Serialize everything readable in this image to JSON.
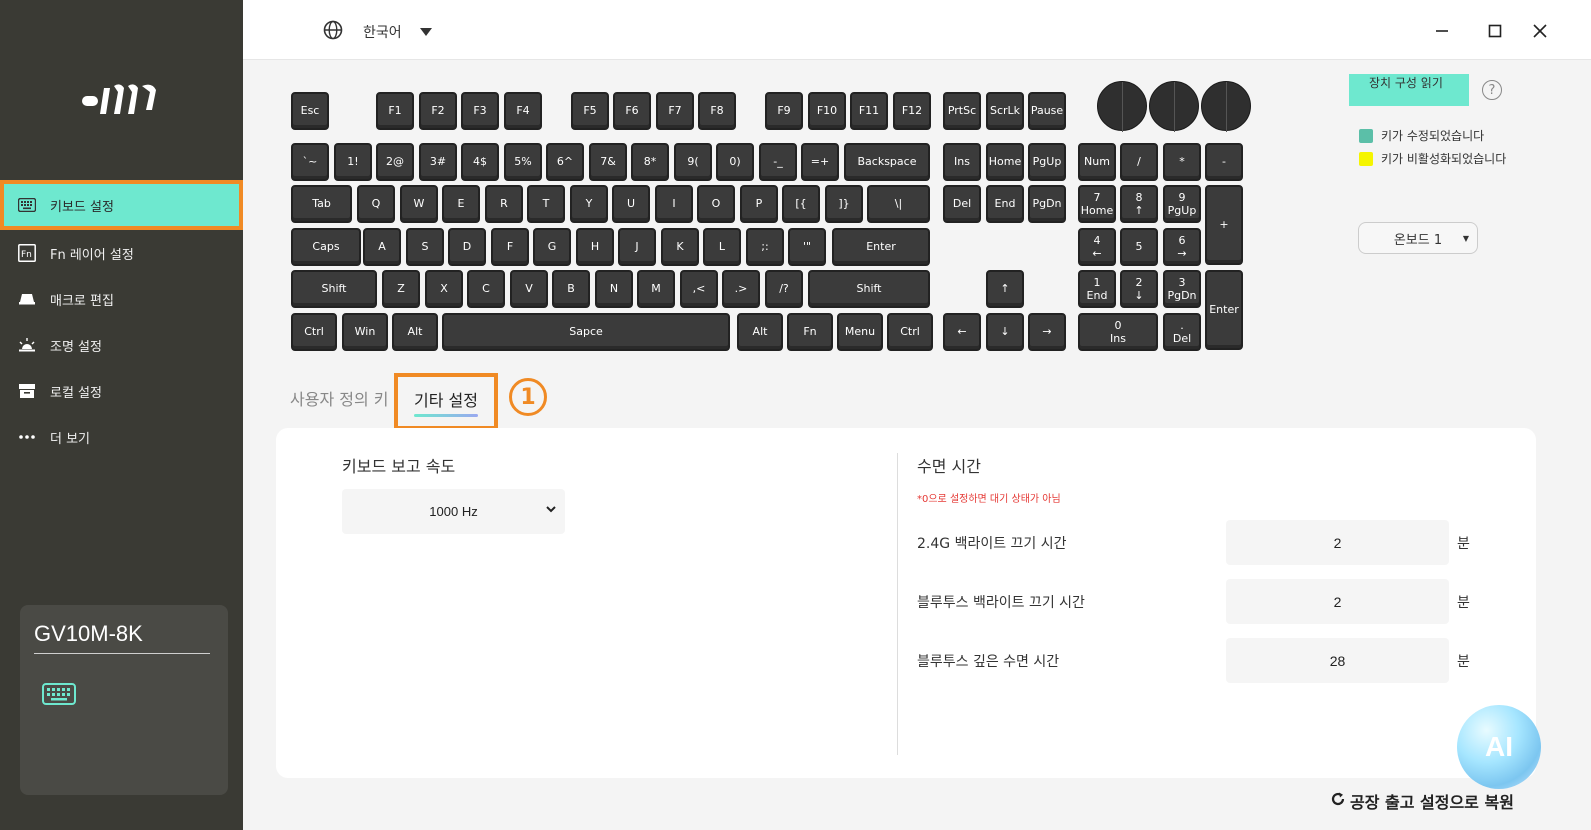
{
  "language": {
    "label": "한국어",
    "icons": [
      "globe-icon",
      "caret-down-icon"
    ]
  },
  "window_controls": {
    "minimize": "minimize-icon",
    "maximize": "maximize-icon",
    "close": "close-icon"
  },
  "sidebar": {
    "items": [
      {
        "label": "키보드 설정",
        "icon": "keyboard-icon",
        "active": true
      },
      {
        "label": "Fn 레이어 설정",
        "icon": "fn-icon"
      },
      {
        "label": "매크로 편집",
        "icon": "macro-icon"
      },
      {
        "label": "조명 설정",
        "icon": "light-icon"
      },
      {
        "label": "로컬 설정",
        "icon": "local-icon"
      },
      {
        "label": "더 보기",
        "icon": "more-icon"
      }
    ],
    "device_name": "GV10M-8K"
  },
  "keyboard": {
    "keys": [
      "Esc",
      "F1",
      "F2",
      "F3",
      "F4",
      "F5",
      "F6",
      "F7",
      "F8",
      "F9",
      "F10",
      "F11",
      "F12",
      "PrtSc",
      "ScrLk",
      "Pause",
      "`~",
      "1!",
      "2@",
      "3#",
      "4$",
      "5%",
      "6^",
      "7&",
      "8*",
      "9(",
      "0)",
      "-_",
      "=+",
      "Backspace",
      "Ins",
      "Home",
      "PgUp",
      "Num",
      "/",
      "*",
      "-",
      "Tab",
      "Q",
      "W",
      "E",
      "R",
      "T",
      "Y",
      "U",
      "I",
      "O",
      "P",
      "[{",
      "]}",
      "\\|",
      "Del",
      "End",
      "PgDn",
      "7\nHome",
      "8\n↑",
      "9\nPgUp",
      "+",
      "Caps",
      "A",
      "S",
      "D",
      "F",
      "G",
      "H",
      "J",
      "K",
      "L",
      ";:",
      "'\"",
      "Enter",
      "4\n←",
      "5",
      "6\n→",
      "Shift",
      "Z",
      "X",
      "C",
      "V",
      "B",
      "N",
      "M",
      ",<",
      ".>",
      "/?",
      "Shift",
      "↑",
      "1\nEnd",
      "2\n↓",
      "3\nPgDn",
      "Enter",
      "Ctrl",
      "Win",
      "Alt",
      "Sapce",
      "Alt",
      "Fn",
      "Menu",
      "Ctrl",
      "←",
      "↓",
      "→",
      "0\nIns",
      ".\nDel"
    ]
  },
  "read_config_button": "장치 구성 읽기",
  "help_glyph": "?",
  "legend": [
    {
      "label": "키가 수정되었습니다",
      "color": "#5bbfa8"
    },
    {
      "label": "키가 비활성화되었습니다",
      "color": "#f5f500"
    }
  ],
  "onboard": {
    "label": "온보드 1"
  },
  "tabs": {
    "user_keys": "사용자 정의 키",
    "other_settings": "기타 설정",
    "step_badge": "1"
  },
  "panel": {
    "report_rate": {
      "label": "키보드 보고 속도",
      "value": "1000 Hz"
    },
    "sleep": {
      "label": "수면 시간",
      "note": "*0으로 설정하면 대기 상태가 아님",
      "rows": [
        {
          "label": "2.4G 백라이트 끄기 시간",
          "value": "2",
          "unit": "분"
        },
        {
          "label": "블루투스 백라이트 끄기 시간",
          "value": "2",
          "unit": "분"
        },
        {
          "label": "블루투스 깊은 수면 시간",
          "value": "28",
          "unit": "분"
        }
      ]
    }
  },
  "reset_button": "공장 출고 설정으로 복원",
  "ai_button": "AI"
}
